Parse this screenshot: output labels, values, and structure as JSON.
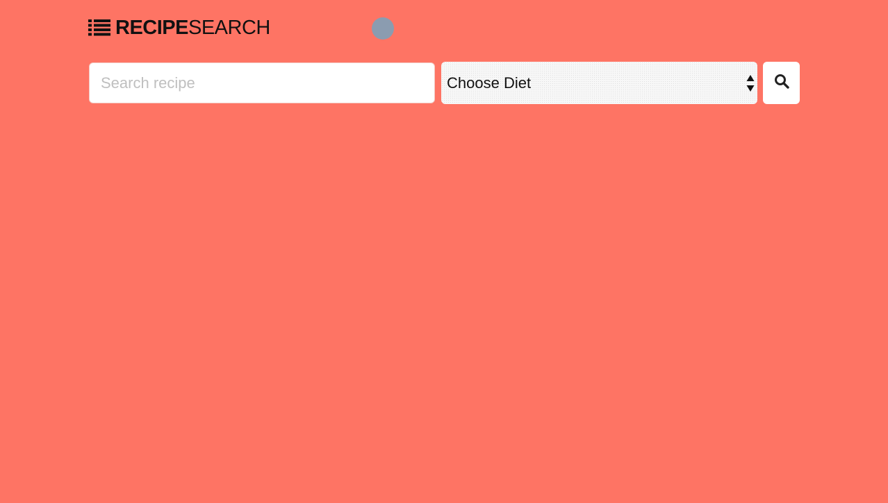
{
  "header": {
    "logo_bold": "RECIPE",
    "logo_light": "SEARCH",
    "logo_icon": "list-icon"
  },
  "status_indicator": {
    "color": "#8b9cb0"
  },
  "search": {
    "placeholder": "Search recipe",
    "value": ""
  },
  "diet_select": {
    "selected_label": "Choose Diet",
    "arrow_icon": "up-down-arrows-icon"
  },
  "search_button": {
    "icon": "search-icon"
  },
  "theme": {
    "background": "#fe7464",
    "text": "#111111",
    "input_background": "#ffffff"
  }
}
